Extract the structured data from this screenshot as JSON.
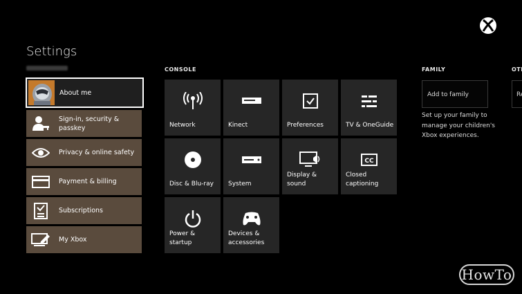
{
  "page": {
    "title": "Settings"
  },
  "left_menu": [
    {
      "label": "About me",
      "icon": "avatar"
    },
    {
      "label": "Sign-in, security & passkey",
      "icon": "user-key-icon"
    },
    {
      "label": "Privacy & online safety",
      "icon": "eye-icon"
    },
    {
      "label": "Payment & billing",
      "icon": "credit-card-icon"
    },
    {
      "label": "Subscriptions",
      "icon": "clipboard-check-icon"
    },
    {
      "label": "My Xbox",
      "icon": "console-edit-icon"
    }
  ],
  "console": {
    "header": "CONSOLE",
    "tiles": [
      {
        "label": "Network",
        "icon": "network-icon"
      },
      {
        "label": "Kinect",
        "icon": "kinect-icon"
      },
      {
        "label": "Preferences",
        "icon": "checkbox-icon"
      },
      {
        "label": "TV & OneGuide",
        "icon": "tv-guide-icon"
      },
      {
        "label": "Disc & Blu-ray",
        "icon": "disc-icon"
      },
      {
        "label": "System",
        "icon": "system-icon"
      },
      {
        "label": "Display & sound",
        "icon": "display-sound-icon"
      },
      {
        "label": "Closed captioning",
        "icon": "cc-icon"
      },
      {
        "label": "Power & startup",
        "icon": "power-icon"
      },
      {
        "label": "Devices & accessories",
        "icon": "controller-icon"
      }
    ]
  },
  "family": {
    "header": "FAMILY",
    "button_label": "Add to family",
    "description": "Set up your family to manage your children's Xbox experiences."
  },
  "other": {
    "header": "OTH",
    "button_label": "Re"
  },
  "watermark": {
    "text": "HowTo"
  },
  "colors": {
    "tile_bg": "#262626",
    "menu_bg": "#5a4b3d",
    "background": "#000000"
  }
}
